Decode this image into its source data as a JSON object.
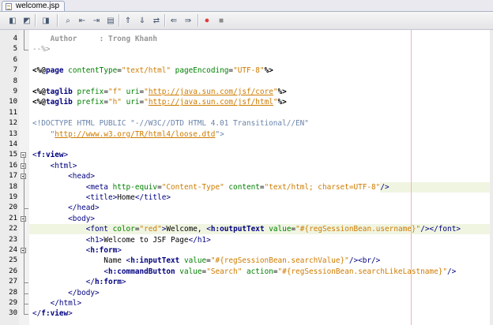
{
  "tab": {
    "title": "welcome.jsp"
  },
  "toolbar": {
    "buttons": [
      {
        "name": "last-edit-icon",
        "glyph": "◧"
      },
      {
        "name": "back-icon",
        "glyph": "◩"
      },
      {
        "name": "forward-icon",
        "glyph": "◨"
      },
      {
        "name": "find-icon",
        "glyph": "⌕"
      },
      {
        "name": "find-previous-icon",
        "glyph": "⇤"
      },
      {
        "name": "find-next-icon",
        "glyph": "⇥"
      },
      {
        "name": "toggle-highlight-icon",
        "glyph": "▤"
      },
      {
        "name": "previous-bookmark-icon",
        "glyph": "⇑"
      },
      {
        "name": "next-bookmark-icon",
        "glyph": "⇓"
      },
      {
        "name": "toggle-bookmark-icon",
        "glyph": "⇄"
      },
      {
        "name": "shift-left-icon",
        "glyph": "⇚"
      },
      {
        "name": "shift-right-icon",
        "glyph": "⇛"
      },
      {
        "name": "start-macro-icon",
        "glyph": "●"
      },
      {
        "name": "stop-macro-icon",
        "glyph": "■"
      }
    ]
  },
  "colors": {
    "tag": "#000080",
    "attribute": "#008000",
    "string": "#ce7b00",
    "comment": "#969696",
    "doctype": "#6a84aa",
    "margin_line": "#f3b2b2",
    "highlight": "#f0f5e2",
    "record": "#e03c3c"
  },
  "lines": [
    {
      "n": "4",
      "segs": [
        [
          "t-text",
          "    "
        ],
        [
          "t-cmtb",
          "Author     : Trong Khanh"
        ]
      ]
    },
    {
      "n": "5",
      "segs": [
        [
          "t-cmt",
          "--%>"
        ]
      ]
    },
    {
      "n": "6",
      "segs": []
    },
    {
      "n": "7",
      "segs": [
        [
          "t-dlm",
          "<%@"
        ],
        [
          "t-dir",
          "page "
        ],
        [
          "t-attr",
          "contentType"
        ],
        [
          "t-text",
          "="
        ],
        [
          "t-str",
          "\"text/html\""
        ],
        [
          "t-text",
          " "
        ],
        [
          "t-attr",
          "pageEncoding"
        ],
        [
          "t-text",
          "="
        ],
        [
          "t-str",
          "\"UTF-8\""
        ],
        [
          "t-dlm",
          "%>"
        ]
      ]
    },
    {
      "n": "8",
      "segs": []
    },
    {
      "n": "9",
      "segs": [
        [
          "t-dlm",
          "<%@"
        ],
        [
          "t-dir",
          "taglib "
        ],
        [
          "t-attr",
          "prefix"
        ],
        [
          "t-text",
          "="
        ],
        [
          "t-str",
          "\"f\""
        ],
        [
          "t-text",
          " "
        ],
        [
          "t-attr",
          "uri"
        ],
        [
          "t-text",
          "="
        ],
        [
          "t-str",
          "\""
        ],
        [
          "t-url",
          "http://java.sun.com/jsf/core"
        ],
        [
          "t-str",
          "\""
        ],
        [
          "t-dlm",
          "%>"
        ]
      ]
    },
    {
      "n": "10",
      "segs": [
        [
          "t-dlm",
          "<%@"
        ],
        [
          "t-dir",
          "taglib "
        ],
        [
          "t-attr",
          "prefix"
        ],
        [
          "t-text",
          "="
        ],
        [
          "t-str",
          "\"h\""
        ],
        [
          "t-text",
          " "
        ],
        [
          "t-attr",
          "uri"
        ],
        [
          "t-text",
          "="
        ],
        [
          "t-str",
          "\""
        ],
        [
          "t-url",
          "http://java.sun.com/jsf/html"
        ],
        [
          "t-str",
          "\""
        ],
        [
          "t-dlm",
          "%>"
        ]
      ]
    },
    {
      "n": "11",
      "segs": []
    },
    {
      "n": "12",
      "segs": [
        [
          "t-doc",
          "<!DOCTYPE HTML PUBLIC \"-//W3C//DTD HTML 4.01 Transitional//EN\""
        ]
      ]
    },
    {
      "n": "13",
      "segs": [
        [
          "t-doc",
          "    \""
        ],
        [
          "t-url",
          "http://www.w3.org/TR/html4/loose.dtd"
        ],
        [
          "t-doc",
          "\">"
        ]
      ]
    },
    {
      "n": "14",
      "segs": []
    },
    {
      "n": "15",
      "segs": [
        [
          "t-tag",
          "<"
        ],
        [
          "t-tagb",
          "f:view"
        ],
        [
          "t-tag",
          ">"
        ]
      ]
    },
    {
      "n": "16",
      "segs": [
        [
          "t-text",
          "    "
        ],
        [
          "t-tag",
          "<html>"
        ]
      ]
    },
    {
      "n": "17",
      "segs": [
        [
          "t-text",
          "        "
        ],
        [
          "t-tag",
          "<head>"
        ]
      ]
    },
    {
      "n": "18",
      "segs": [
        [
          "t-text",
          "            "
        ],
        [
          "t-tag",
          "<meta "
        ],
        [
          "t-attr",
          "http-equiv"
        ],
        [
          "t-text",
          "="
        ],
        [
          "t-str",
          "\"Content-Type\""
        ],
        [
          "t-text",
          " "
        ],
        [
          "t-attr",
          "content"
        ],
        [
          "t-text",
          "="
        ],
        [
          "t-str",
          "\"text/html; charset=UTF-8\""
        ],
        [
          "t-tag",
          "/>"
        ]
      ]
    },
    {
      "n": "19",
      "segs": [
        [
          "t-text",
          "            "
        ],
        [
          "t-tag",
          "<title>"
        ],
        [
          "t-text",
          "Home"
        ],
        [
          "t-tag",
          "</title>"
        ]
      ]
    },
    {
      "n": "20",
      "segs": [
        [
          "t-text",
          "        "
        ],
        [
          "t-tag",
          "</head>"
        ]
      ]
    },
    {
      "n": "21",
      "segs": [
        [
          "t-text",
          "        "
        ],
        [
          "t-tag",
          "<body>"
        ]
      ]
    },
    {
      "n": "22",
      "segs": [
        [
          "t-text",
          "            "
        ],
        [
          "t-tag",
          "<font "
        ],
        [
          "t-attr",
          "color"
        ],
        [
          "t-text",
          "="
        ],
        [
          "t-str",
          "\"red\""
        ],
        [
          "t-tag",
          ">"
        ],
        [
          "t-text",
          "Welcome, "
        ],
        [
          "t-tag",
          "<"
        ],
        [
          "t-tagb",
          "h:outputText"
        ],
        [
          "t-text",
          " "
        ],
        [
          "t-attr",
          "value"
        ],
        [
          "t-text",
          "="
        ],
        [
          "t-str",
          "\"#{regSessionBean.username}\""
        ],
        [
          "t-tag",
          "/>"
        ],
        [
          "t-tag",
          "</font>"
        ]
      ]
    },
    {
      "n": "23",
      "segs": [
        [
          "t-text",
          "            "
        ],
        [
          "t-tag",
          "<h1>"
        ],
        [
          "t-text",
          "Welcome to JSF Page"
        ],
        [
          "t-tag",
          "</h1>"
        ]
      ]
    },
    {
      "n": "24",
      "segs": [
        [
          "t-text",
          "            "
        ],
        [
          "t-tag",
          "<"
        ],
        [
          "t-tagb",
          "h:form"
        ],
        [
          "t-tag",
          ">"
        ]
      ]
    },
    {
      "n": "25",
      "segs": [
        [
          "t-text",
          "                Name "
        ],
        [
          "t-tag",
          "<"
        ],
        [
          "t-tagb",
          "h:inputText"
        ],
        [
          "t-text",
          " "
        ],
        [
          "t-attr",
          "value"
        ],
        [
          "t-text",
          "="
        ],
        [
          "t-str",
          "\"#{regSessionBean.searchValue}\""
        ],
        [
          "t-tag",
          "/>"
        ],
        [
          "t-tag",
          "<br/>"
        ]
      ]
    },
    {
      "n": "26",
      "segs": [
        [
          "t-text",
          "                "
        ],
        [
          "t-tag",
          "<"
        ],
        [
          "t-tagb",
          "h:commandButton"
        ],
        [
          "t-text",
          " "
        ],
        [
          "t-attr",
          "value"
        ],
        [
          "t-text",
          "="
        ],
        [
          "t-str",
          "\"Search\""
        ],
        [
          "t-text",
          " "
        ],
        [
          "t-attr",
          "action"
        ],
        [
          "t-text",
          "="
        ],
        [
          "t-str",
          "\"#{regSessionBean.searchLikeLastname}\""
        ],
        [
          "t-tag",
          "/>"
        ]
      ]
    },
    {
      "n": "27",
      "segs": [
        [
          "t-text",
          "            "
        ],
        [
          "t-tag",
          "</"
        ],
        [
          "t-tagb",
          "h:form"
        ],
        [
          "t-tag",
          ">"
        ]
      ]
    },
    {
      "n": "28",
      "segs": [
        [
          "t-text",
          "        "
        ],
        [
          "t-tag",
          "</body>"
        ]
      ]
    },
    {
      "n": "29",
      "segs": [
        [
          "t-text",
          "    "
        ],
        [
          "t-tag",
          "</html>"
        ]
      ]
    },
    {
      "n": "30",
      "segs": [
        [
          "t-tag",
          "</"
        ],
        [
          "t-tagb",
          "f:view"
        ],
        [
          "t-tag",
          ">"
        ]
      ]
    }
  ]
}
